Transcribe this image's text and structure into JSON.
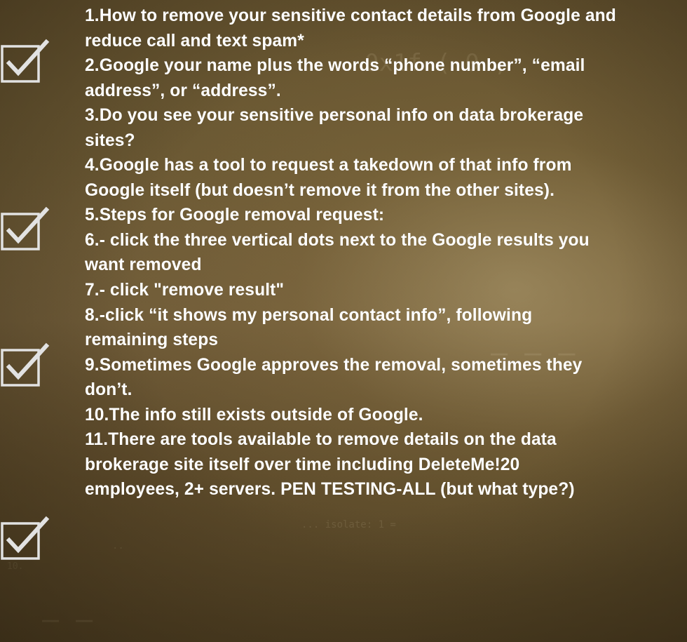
{
  "lines": [
    "1.How to remove your sensitive contact details from Google and",
    "reduce call and text spam*",
    "2.Google your name plus the words “phone number”, “email",
    "address”, or “address”.",
    "3.Do you see your sensitive personal info on data brokerage",
    "sites?",
    "4.Google has a tool to request a takedown of that info from",
    "Google itself (but doesn’t remove it from the other sites).",
    "5.Steps for Google removal request:",
    "6.- click the three vertical dots next to the Google results you",
    "want removed",
    "7.- click \"remove result\"",
    "8.-click “it shows my personal contact info”, following",
    "remaining steps",
    "9.Sometimes Google approves the removal, sometimes they",
    "don’t.",
    "10.The info still exists outside of Google.",
    "11.There are tools available to remove details on the data",
    "brokerage site itself over time including DeleteMe!20",
    "employees, 2+ servers. PEN TESTING-ALL (but what type?)"
  ],
  "checkboxes": [
    {
      "icon": "checkbox-checked-icon",
      "checked": true
    },
    {
      "icon": "checkbox-checked-icon",
      "checked": true
    },
    {
      "icon": "checkbox-checked-icon",
      "checked": true
    },
    {
      "icon": "checkbox-checked-icon",
      "checked": true
    }
  ],
  "colors": {
    "text": "#ffffff",
    "checkbox": "#e2e2e2",
    "background": "#6c5a34"
  }
}
